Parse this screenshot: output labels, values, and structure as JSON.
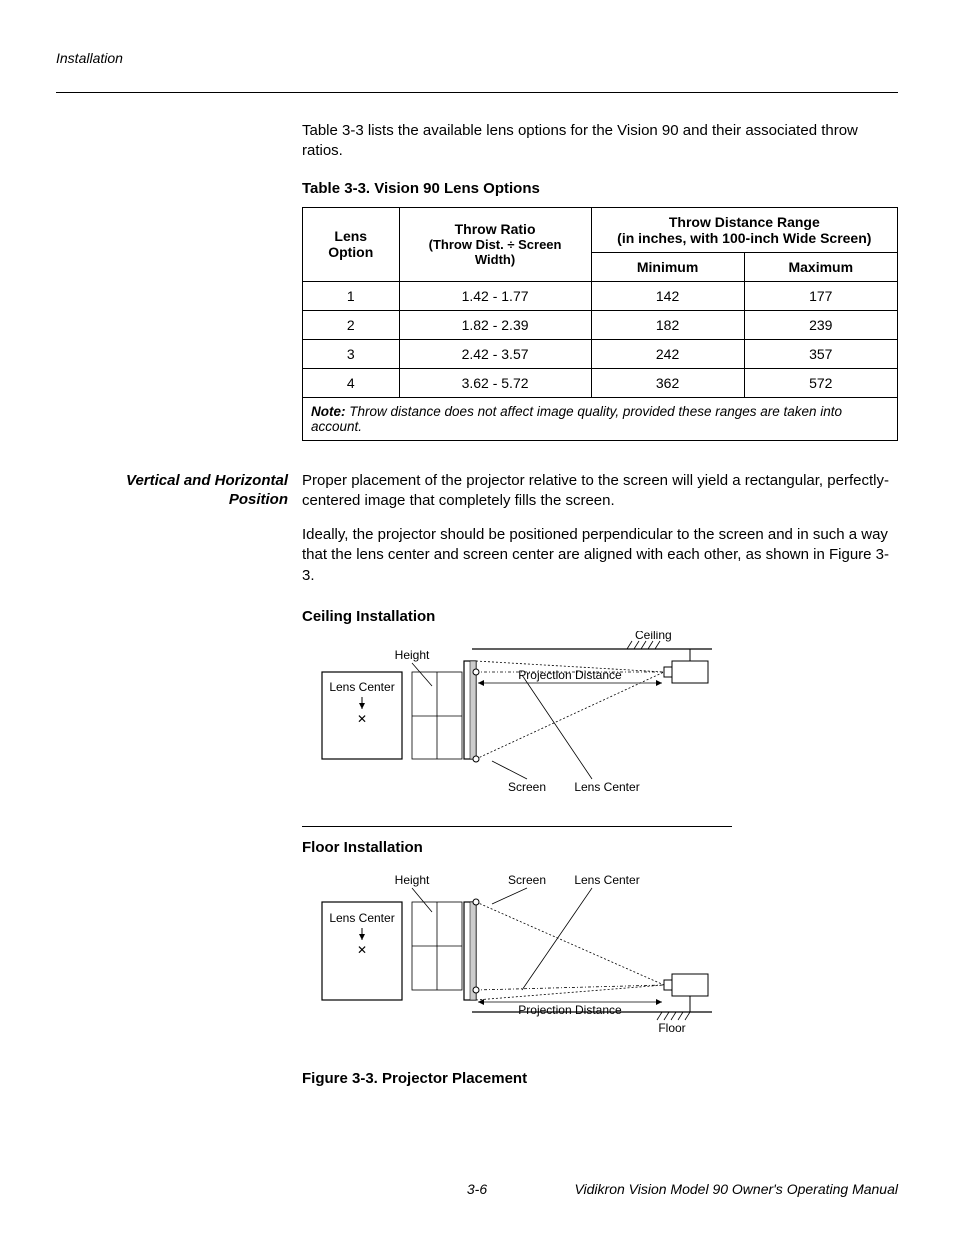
{
  "header": {
    "section": "Installation"
  },
  "intro_para": "Table 3-3 lists the available lens options for the Vision 90 and their associated throw ratios.",
  "table": {
    "title": "Table 3-3. Vision 90 Lens Options",
    "head": {
      "lens_option": "Lens Option",
      "throw_ratio_line1": "Throw Ratio",
      "throw_ratio_line2": "(Throw Dist. ÷ Screen Width)",
      "range_line1": "Throw Distance Range",
      "range_line2": "(in inches, with 100-inch Wide Screen)",
      "min": "Minimum",
      "max": "Maximum"
    },
    "rows": [
      {
        "opt": "1",
        "ratio": "1.42 - 1.77",
        "min": "142",
        "max": "177"
      },
      {
        "opt": "2",
        "ratio": "1.82 - 2.39",
        "min": "182",
        "max": "239"
      },
      {
        "opt": "3",
        "ratio": "2.42 - 3.57",
        "min": "242",
        "max": "357"
      },
      {
        "opt": "4",
        "ratio": "3.62 - 5.72",
        "min": "362",
        "max": "572"
      }
    ],
    "note_label": "Note:",
    "note_text": " Throw distance does not affect image quality, provided these ranges are taken into account."
  },
  "section": {
    "margin_note": "Vertical and Horizontal Position",
    "para1": "Proper placement of the projector relative to the screen will yield a rectangular, perfectly-centered image that completely fills the screen.",
    "para2": "Ideally, the projector should be positioned perpendicular to the screen and in such a way that the lens center and screen center are aligned with each other, as shown in Figure 3-3."
  },
  "figures": {
    "ceiling": {
      "heading": "Ceiling Installation",
      "labels": {
        "ceiling": "Ceiling",
        "height": "Height",
        "lens_center_left": "Lens Center",
        "proj_dist": "Projection Distance",
        "screen": "Screen",
        "lens_center_bottom": "Lens Center"
      }
    },
    "floor": {
      "heading": "Floor Installation",
      "labels": {
        "height": "Height",
        "screen": "Screen",
        "lens_center_top": "Lens Center",
        "lens_center_left": "Lens Center",
        "proj_dist": "Projection Distance",
        "floor": "Floor"
      }
    },
    "caption": "Figure 3-3. Projector Placement"
  },
  "footer": {
    "page": "3-6",
    "manual": "Vidikron Vision Model 90 Owner's Operating Manual"
  }
}
